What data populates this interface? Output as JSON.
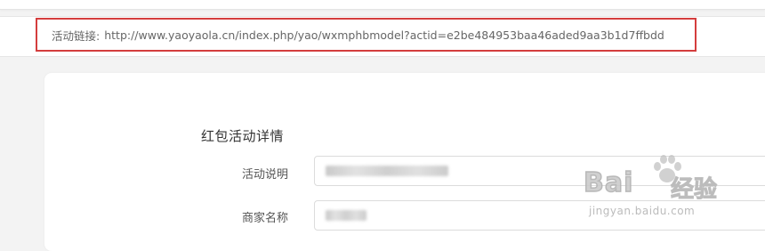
{
  "activity_link": {
    "label": "活动链接:",
    "url": "http://www.yaoyaola.cn/index.php/yao/wxmphbmodel?actid=e2be484953baa46aded9aa3b1d7ffbdd"
  },
  "form": {
    "section_title": "红包活动详情",
    "fields": [
      {
        "label": "活动说明"
      },
      {
        "label": "商家名称"
      }
    ]
  },
  "watermark": {
    "brand": "Bai",
    "brand_suffix": "经验",
    "url": "jingyan.baidu.com"
  },
  "colors": {
    "highlight_border": "#d43d3d",
    "background": "#f3f3f3"
  }
}
